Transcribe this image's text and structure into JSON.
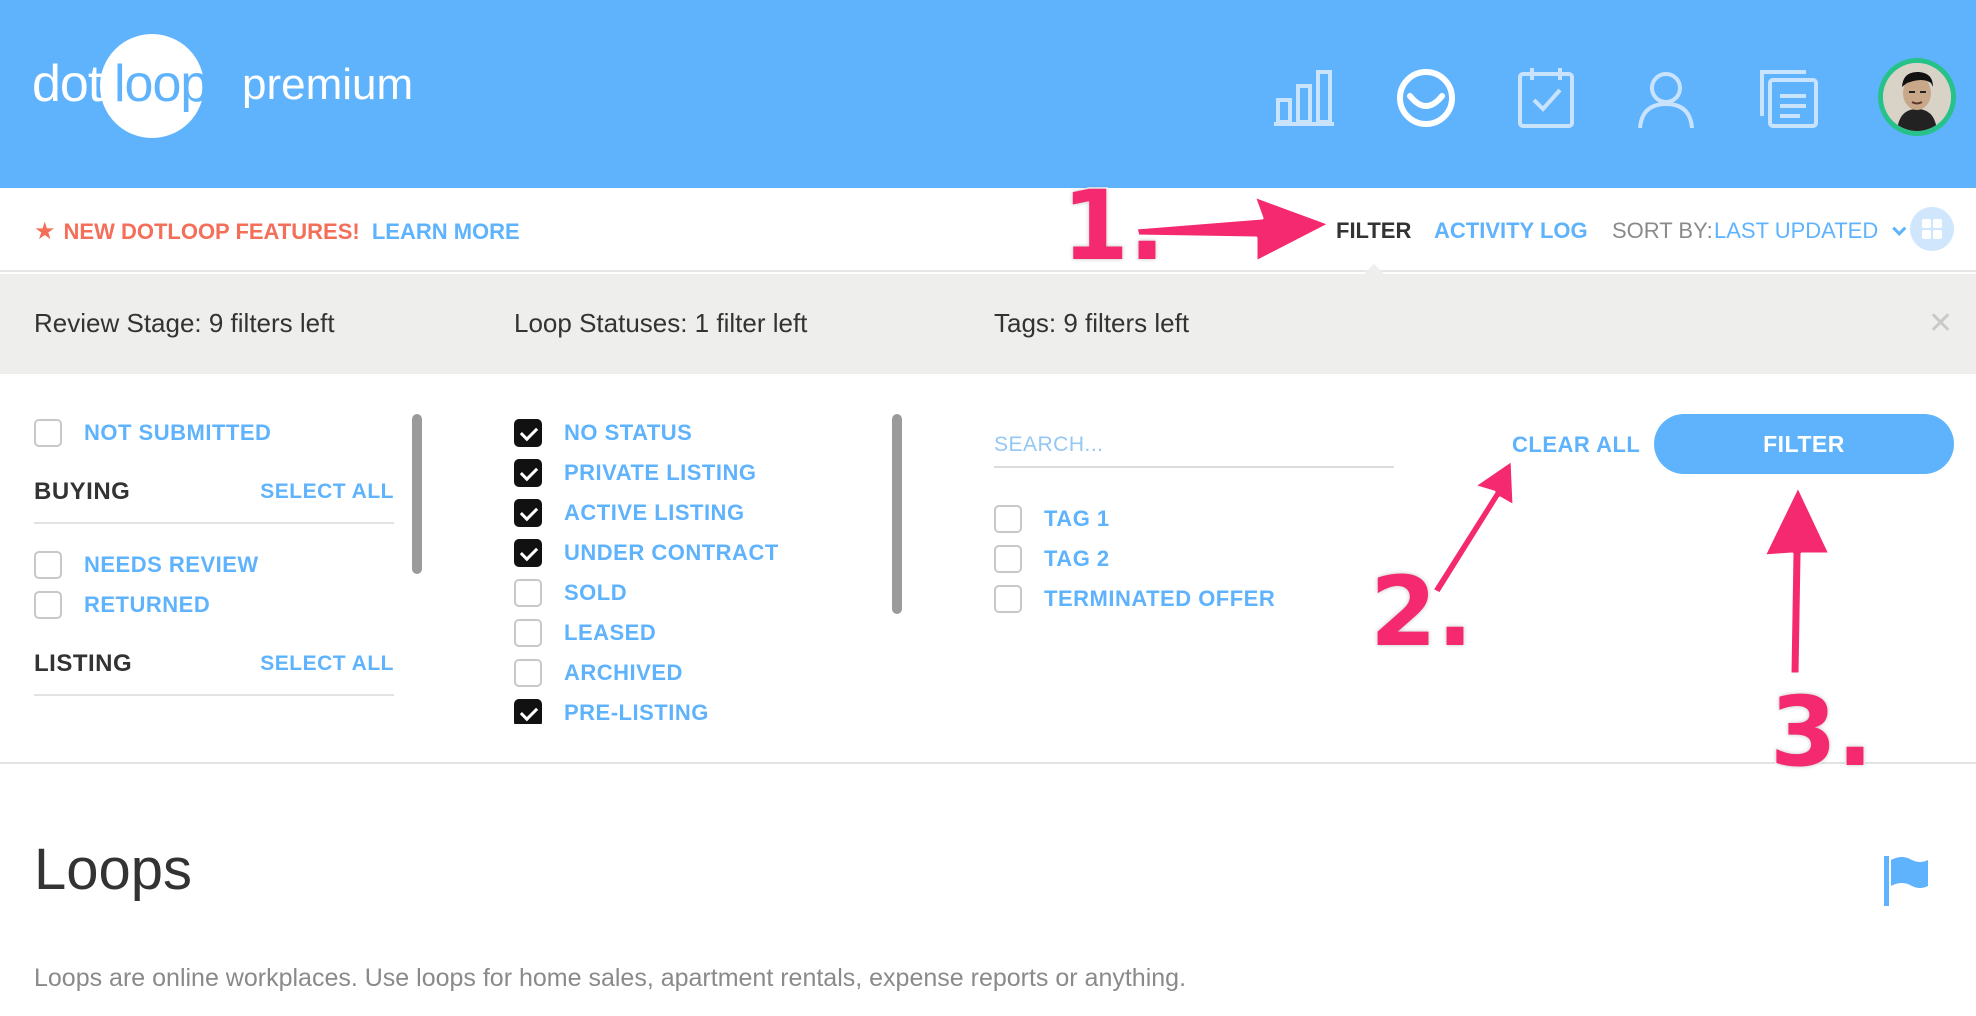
{
  "header": {
    "logo_dot": "dot",
    "logo_loop": "loop",
    "logo_premium": "premium",
    "nav_icons": [
      "stats-icon",
      "smile-icon",
      "tasks-icon",
      "profile-icon",
      "documents-icon"
    ],
    "accent_color": "#5fb3fd"
  },
  "subbar": {
    "new_features": "NEW DOTLOOP FEATURES!",
    "learn_more": "LEARN MORE",
    "filter": "FILTER",
    "activity_log": "ACTIVITY LOG",
    "sort_by_label": "SORT BY:",
    "sort_by_value": "LAST UPDATED"
  },
  "stages": {
    "review": "Review Stage: 9 filters left",
    "loop_statuses": "Loop Statuses: 1 filter left",
    "tags": "Tags: 9 filters left"
  },
  "review": {
    "not_submitted": "NOT SUBMITTED",
    "buying": {
      "label": "BUYING",
      "select_all": "SELECT ALL"
    },
    "needs_review": "NEEDS REVIEW",
    "returned": "RETURNED",
    "listing": {
      "label": "LISTING",
      "select_all": "SELECT ALL"
    }
  },
  "statuses": [
    {
      "label": "NO STATUS",
      "checked": true
    },
    {
      "label": "PRIVATE LISTING",
      "checked": true
    },
    {
      "label": "ACTIVE LISTING",
      "checked": true
    },
    {
      "label": "UNDER CONTRACT",
      "checked": true
    },
    {
      "label": "SOLD",
      "checked": false
    },
    {
      "label": "LEASED",
      "checked": false
    },
    {
      "label": "ARCHIVED",
      "checked": false
    },
    {
      "label": "PRE-LISTING",
      "checked": true
    }
  ],
  "tags": {
    "search_placeholder": "SEARCH...",
    "items": [
      "TAG 1",
      "TAG 2",
      "TERMINATED OFFER"
    ]
  },
  "actions": {
    "clear_all": "CLEAR ALL",
    "filter_button": "FILTER"
  },
  "loops": {
    "title": "Loops",
    "description": "Loops are online workplaces. Use loops for home sales, apartment rentals, expense reports or anything."
  },
  "annotations": {
    "step1": "1.",
    "step2": "2.",
    "step3": "3.",
    "color": "#f4296f"
  }
}
